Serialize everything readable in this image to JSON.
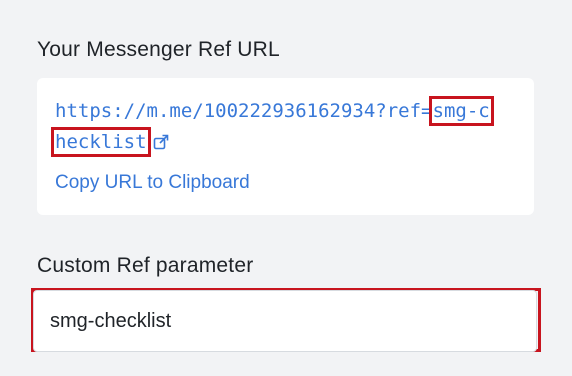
{
  "ref_url_section": {
    "title": "Your Messenger Ref URL",
    "url_prefix": "https://m.me/100222936162934?ref=",
    "url_param": "smg-checklist",
    "copy_label": "Copy URL to Clipboard"
  },
  "custom_ref_section": {
    "title": "Custom Ref parameter",
    "input_value": "smg-checklist"
  },
  "icons": {
    "external_link": "external-link-icon"
  },
  "colors": {
    "link": "#3878d8",
    "highlight": "#c8141e",
    "background": "#f2f3f5"
  }
}
